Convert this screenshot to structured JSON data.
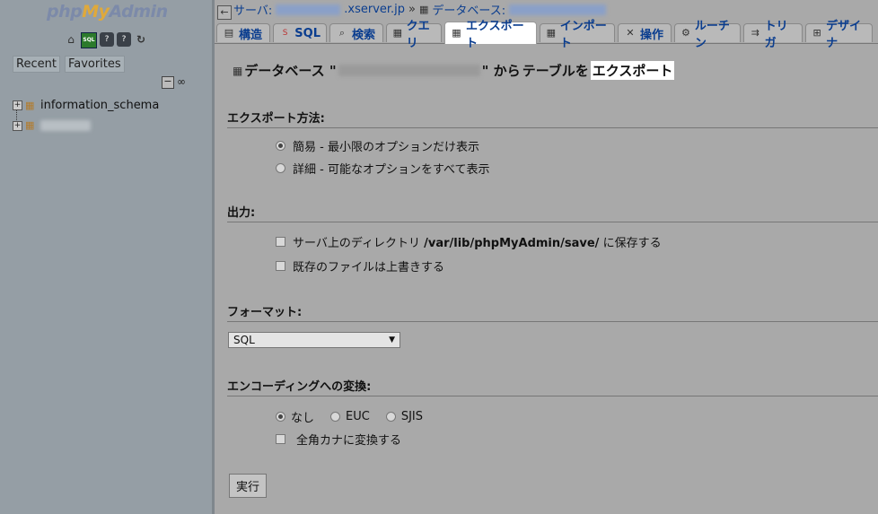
{
  "sidebar": {
    "logo": {
      "php": "php",
      "my": "My",
      "admin": "Admin"
    },
    "icons": [
      "home-icon",
      "sql-query-icon",
      "docs-icon",
      "docs-alt-icon",
      "reload-icon"
    ],
    "tabs": [
      "Recent",
      "Favorites"
    ],
    "tree": [
      {
        "label": "information_schema",
        "expander": "+"
      },
      {
        "label": "",
        "expander": "+"
      }
    ]
  },
  "breadcrumb": {
    "back": "←",
    "server_label": "サーバ:",
    "server_suffix": ".xserver.jp",
    "separator": "»",
    "db_label": "データベース:"
  },
  "tabs": [
    {
      "label": "構造",
      "icon": "structure-icon"
    },
    {
      "label": "SQL",
      "icon": "sql-icon"
    },
    {
      "label": "検索",
      "icon": "search-icon"
    },
    {
      "label": "クエリ",
      "icon": "query-icon"
    },
    {
      "label": "エクスポート",
      "icon": "export-icon",
      "active": true
    },
    {
      "label": "インポート",
      "icon": "import-icon"
    },
    {
      "label": "操作",
      "icon": "operations-icon"
    },
    {
      "label": "ルーチン",
      "icon": "routines-icon"
    },
    {
      "label": "トリガ",
      "icon": "triggers-icon"
    },
    {
      "label": "デザイナ",
      "icon": "designer-icon"
    }
  ],
  "page": {
    "title_prefix": "データベース \"",
    "title_suffix": "\" から",
    "title_tables": "テーブルを",
    "title_export": "エクスポート"
  },
  "export_method": {
    "heading": "エクスポート方法:",
    "options": [
      {
        "label": "簡易 - 最小限のオプションだけ表示",
        "checked": true
      },
      {
        "label": "詳細 - 可能なオプションをすべて表示",
        "checked": false
      }
    ]
  },
  "output": {
    "heading": "出力:",
    "save_prefix": "サーバ上のディレクトリ",
    "save_path": "/var/lib/phpMyAdmin/save/",
    "save_suffix": "に保存する",
    "overwrite": "既存のファイルは上書きする"
  },
  "format": {
    "heading": "フォーマット:",
    "selected": "SQL",
    "arrow": "▼"
  },
  "encoding": {
    "heading": "エンコーディングへの変換:",
    "options": [
      {
        "label": "なし",
        "checked": true
      },
      {
        "label": "EUC",
        "checked": false
      },
      {
        "label": "SJIS",
        "checked": false
      }
    ],
    "kana": "全角カナに変換する"
  },
  "submit": {
    "label": "実行"
  }
}
